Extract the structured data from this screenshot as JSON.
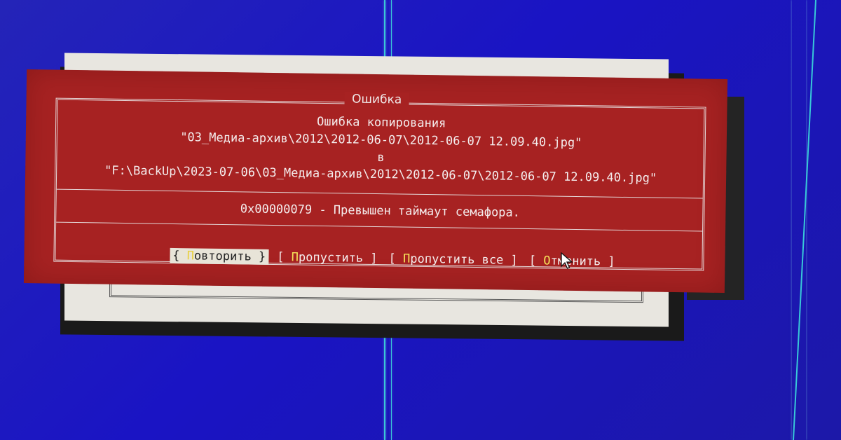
{
  "dialog": {
    "title": "Ошибка",
    "heading": "Ошибка копирования",
    "source_path": "\"03_Медиа-архив\\2012\\2012-06-07\\2012-06-07 12.09.40.jpg\"",
    "to_word": "в",
    "dest_path": "\"F:\\BackUp\\2023-07-06\\03_Медиа-архив\\2012\\2012-06-07\\2012-06-07 12.09.40.jpg\"",
    "error_text": "0x00000079 - Превышен таймаут семафора."
  },
  "buttons": [
    {
      "open": "{ ",
      "hotkey": "П",
      "rest": "овторить",
      "close": " }",
      "focused": true
    },
    {
      "open": "[ ",
      "hotkey": "П",
      "rest": "ропустить",
      "close": " ]",
      "focused": false
    },
    {
      "open": "[ ",
      "hotkey": "П",
      "rest": "ропустить все",
      "close": " ]",
      "focused": false
    },
    {
      "open": "[ ",
      "hotkey": "О",
      "rest": "тменить",
      "close": " ]",
      "focused": false
    }
  ],
  "colors": {
    "desktop": "#1a14c4",
    "dialog_bg": "#a72222",
    "hotkey": "#f6e25a",
    "focus_bg": "#e8e4d8",
    "line": "#38c8d8"
  },
  "icons": {
    "pointer": "mouse-pointer-icon"
  }
}
